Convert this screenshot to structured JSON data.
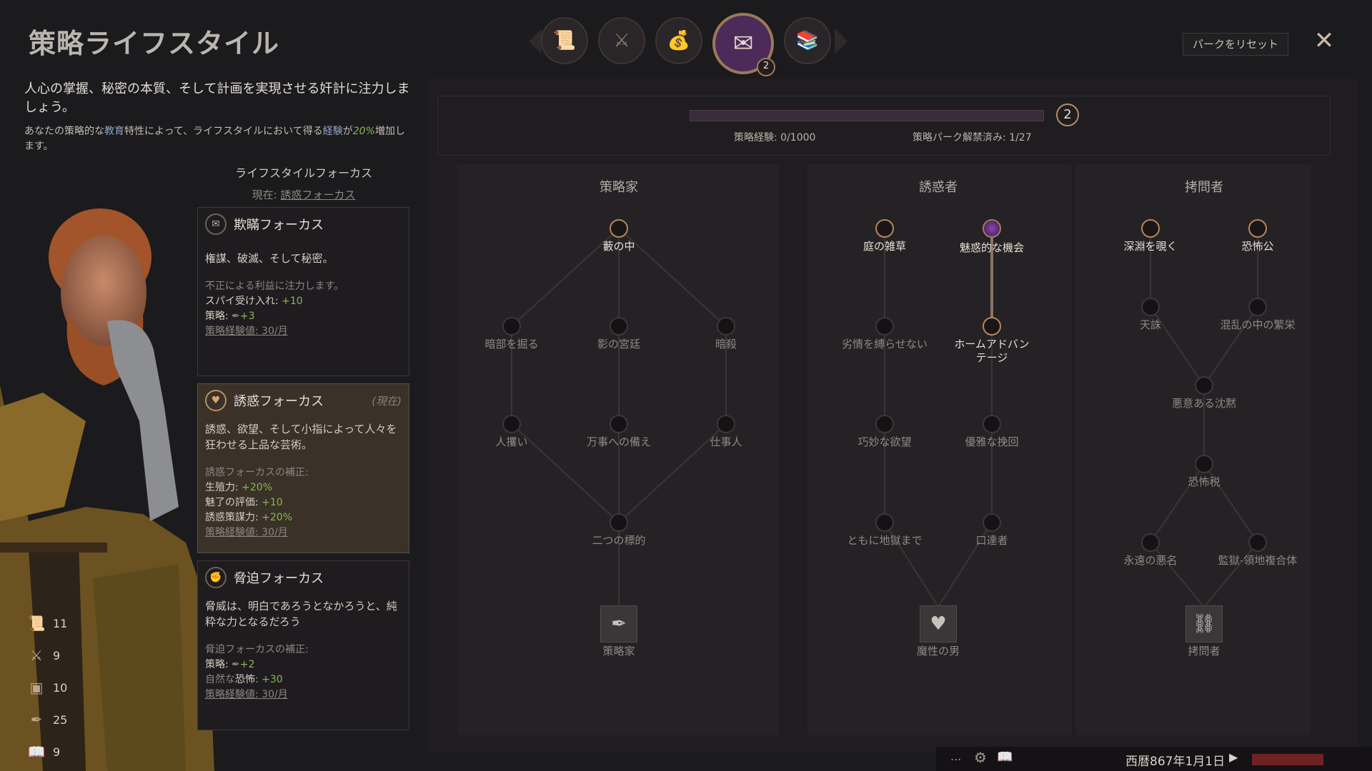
{
  "header": {
    "title": "策略ライフスタイル",
    "reset_label": "パークをリセット",
    "close_icon": "✕",
    "tab_badge": "2",
    "tabs": [
      {
        "name": "diplomacy-tab",
        "icon": "scroll-icon"
      },
      {
        "name": "martial-tab",
        "icon": "helmet-swords-icon"
      },
      {
        "name": "stewardship-tab",
        "icon": "treasure-chest-icon"
      },
      {
        "name": "intrigue-tab",
        "icon": "letter-dagger-icon",
        "active": true
      },
      {
        "name": "learning-tab",
        "icon": "books-icon"
      }
    ]
  },
  "description": {
    "main": "人心の掌握、秘密の本質、そして計画を実現させる奸計に注力しましょう。",
    "sub_1": "あなたの策略的な",
    "sub_edu": "教育",
    "sub_2": "特性によって、ライフスタイルにおいて得る",
    "sub_xp": "経験",
    "sub_3": "が",
    "sub_pct": "20%",
    "sub_4": "増加します。"
  },
  "focus": {
    "heading": "ライフスタイルフォーカス",
    "current_prefix": "現在: ",
    "current_value": "誘惑フォーカス",
    "cards": {
      "intrigue": {
        "title": "欺瞞フォーカス",
        "desc": "権謀、破滅、そして秘密。",
        "line1": "不正による利益に注力します。",
        "line2_label": "スパイ受け入れ: ",
        "line2_value": "+10",
        "line3_label": "策略: ",
        "line3_value": "+3",
        "line4": "策略経験値: 30/月"
      },
      "seduction": {
        "title": "誘惑フォーカス",
        "current_tag": "(現在)",
        "desc": "誘惑、欲望、そして小指によって人々を狂わせる上品な芸術。",
        "line1": "誘惑フォーカスの補正:",
        "line2_label": "生殖力: ",
        "line2_value": "+20%",
        "line3_label": "魅了",
        "line3_mid": "の評価: ",
        "line3_value": "+10",
        "line4_label": "誘惑策謀力: ",
        "line4_value": "+20%",
        "line5": "策略経験値: 30/月"
      },
      "intimidation": {
        "title": "脅迫フォーカス",
        "desc": "脅威は、明白であろうとなかろうと、純粋な力となるだろう",
        "line1": "脅迫フォーカスの補正:",
        "line2_label": "策略: ",
        "line2_value": "+2",
        "line3_pre": "自然な",
        "line3_label": "恐怖",
        "line3_value": ": +30",
        "line4": "策略経験値: 30/月"
      }
    }
  },
  "stats": [
    {
      "icon": "diplomacy-icon",
      "value": "11"
    },
    {
      "icon": "martial-icon",
      "value": "9"
    },
    {
      "icon": "stewardship-icon",
      "value": "10"
    },
    {
      "icon": "intrigue-icon",
      "value": "25"
    },
    {
      "icon": "learning-icon",
      "value": "9"
    }
  ],
  "progress": {
    "xp_label": "策略経験: 0/1000",
    "xp_fraction": 0.0,
    "perks_label": "策略パーク解禁済み: 1/27",
    "points": "2"
  },
  "trees": {
    "schemer": {
      "title": "策略家",
      "trait": "策略家",
      "perks": [
        "藪の中",
        "暗部を掘る",
        "影の宮廷",
        "暗殺",
        "人攫い",
        "万事への備え",
        "仕事人",
        "二つの標的"
      ]
    },
    "seducer": {
      "title": "誘惑者",
      "trait": "魔性の男",
      "perks": [
        "庭の雑草",
        "魅惑的な機会",
        "劣情を縛らせない",
        "ホームアドバンテージ",
        "巧妙な欲望",
        "優雅な挽回",
        "ともに地獄まで",
        "口達者"
      ]
    },
    "torturer": {
      "title": "拷問者",
      "trait": "拷問者",
      "perks": [
        "深淵を覗く",
        "恐怖公",
        "天誅",
        "混乱の中の繁栄",
        "悪意ある沈黙",
        "恐怖税",
        "永遠の悪名",
        "監獄-領地複合体"
      ]
    }
  },
  "bottom": {
    "date": "西暦867年1月1日",
    "dots": "...",
    "gear": "⚙",
    "book": "📖",
    "play": "▶"
  }
}
